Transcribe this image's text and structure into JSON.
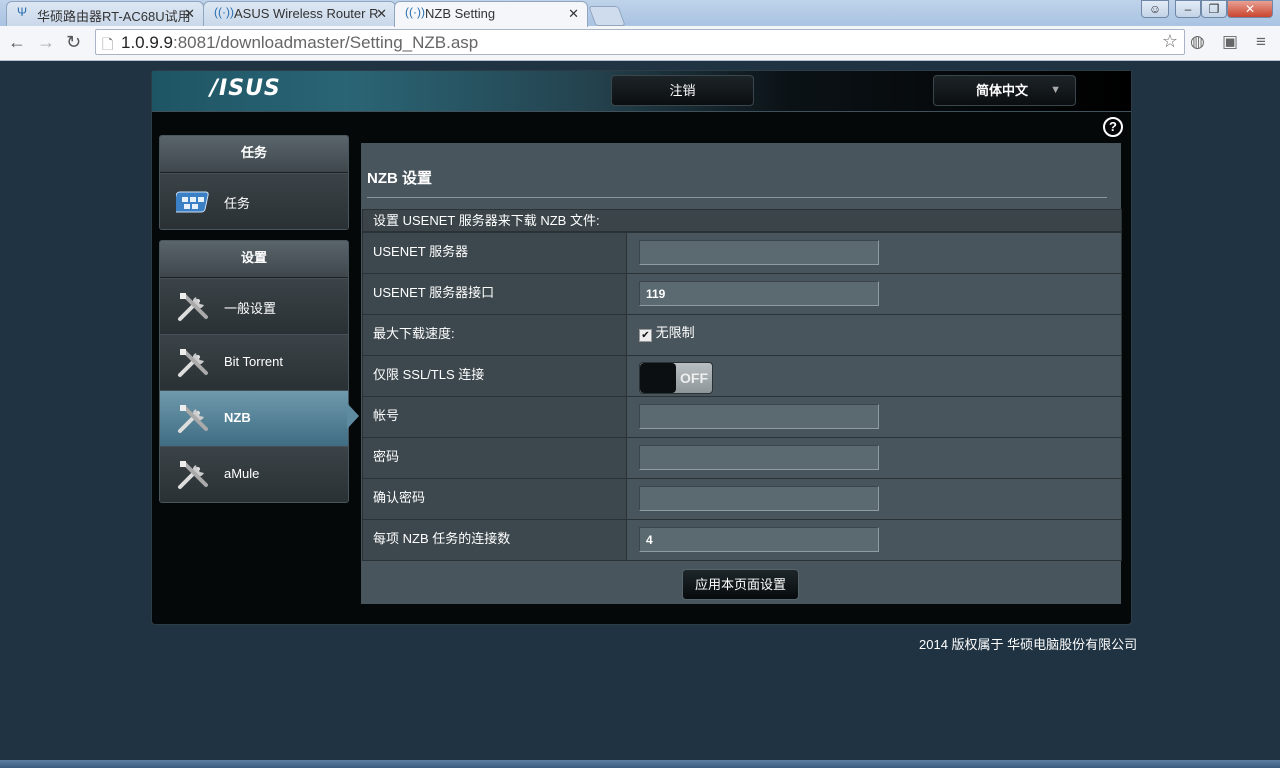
{
  "browser": {
    "tabs": [
      {
        "title": "华硕路由器RT-AC68U试用",
        "active": false
      },
      {
        "title": "ASUS Wireless Router R",
        "active": false
      },
      {
        "title": "NZB Setting",
        "active": true
      }
    ],
    "url_host": "1.0.9.9",
    "url_rest": ":8081/downloadmaster/Setting_NZB.asp",
    "icons": [
      "back-icon",
      "forward-icon",
      "reload-icon",
      "star-icon",
      "user-icon",
      "minimize-icon",
      "restore-icon",
      "close-icon"
    ]
  },
  "header": {
    "logo": "/ISUS",
    "logout": "注销",
    "language": "简体中文",
    "help": "?"
  },
  "sidebar": {
    "groups": [
      {
        "title": "任务",
        "items": [
          {
            "label": "任务",
            "icon": "task-list-icon"
          }
        ]
      },
      {
        "title": "设置",
        "items": [
          {
            "label": "一般设置",
            "icon": "tools-icon"
          },
          {
            "label": "Bit Torrent",
            "icon": "tools-icon"
          },
          {
            "label": "NZB",
            "icon": "tools-icon",
            "active": true
          },
          {
            "label": "aMule",
            "icon": "tools-icon"
          }
        ]
      }
    ]
  },
  "content": {
    "title": "NZB 设置",
    "caption": "设置 USENET 服务器来下载 NZB 文件:",
    "fields": {
      "server": {
        "label": "USENET 服务器",
        "value": ""
      },
      "port": {
        "label": "USENET 服务器接口",
        "value": "119"
      },
      "speed": {
        "label": "最大下载速度:",
        "checkbox_label": "无限制",
        "checked": true
      },
      "ssl": {
        "label": "仅限 SSL/TLS 连接",
        "toggle": "OFF"
      },
      "account": {
        "label": "帐号",
        "value": ""
      },
      "password": {
        "label": "密码",
        "value": ""
      },
      "confirm": {
        "label": "确认密码",
        "value": ""
      },
      "connections": {
        "label": "每项 NZB 任务的连接数",
        "value": "4"
      }
    },
    "apply": "应用本页面设置"
  },
  "footer": {
    "copyright": "2014 版权属于 华硕电脑股份有限公司"
  }
}
